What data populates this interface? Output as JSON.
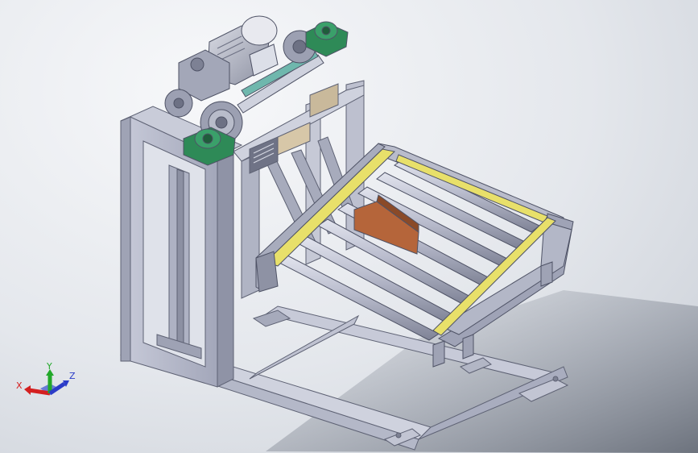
{
  "viewport": {
    "colors": {
      "background_top": "#f7f8fa",
      "background_bottom": "#c9ced6",
      "steel": "#b8bccb",
      "steel_dark": "#8e92a4",
      "steel_light": "#d6d9e4",
      "rail_yellow": "#e8e06a",
      "bearing_green": "#2e8a57",
      "wood_block": "#b5653a",
      "roller": "#aeb2c4"
    }
  },
  "triad": {
    "x_label": "X",
    "y_label": "Y",
    "z_label": "Z",
    "colors": {
      "x": "#d42020",
      "y": "#22a82a",
      "z": "#2b3cc8"
    }
  }
}
